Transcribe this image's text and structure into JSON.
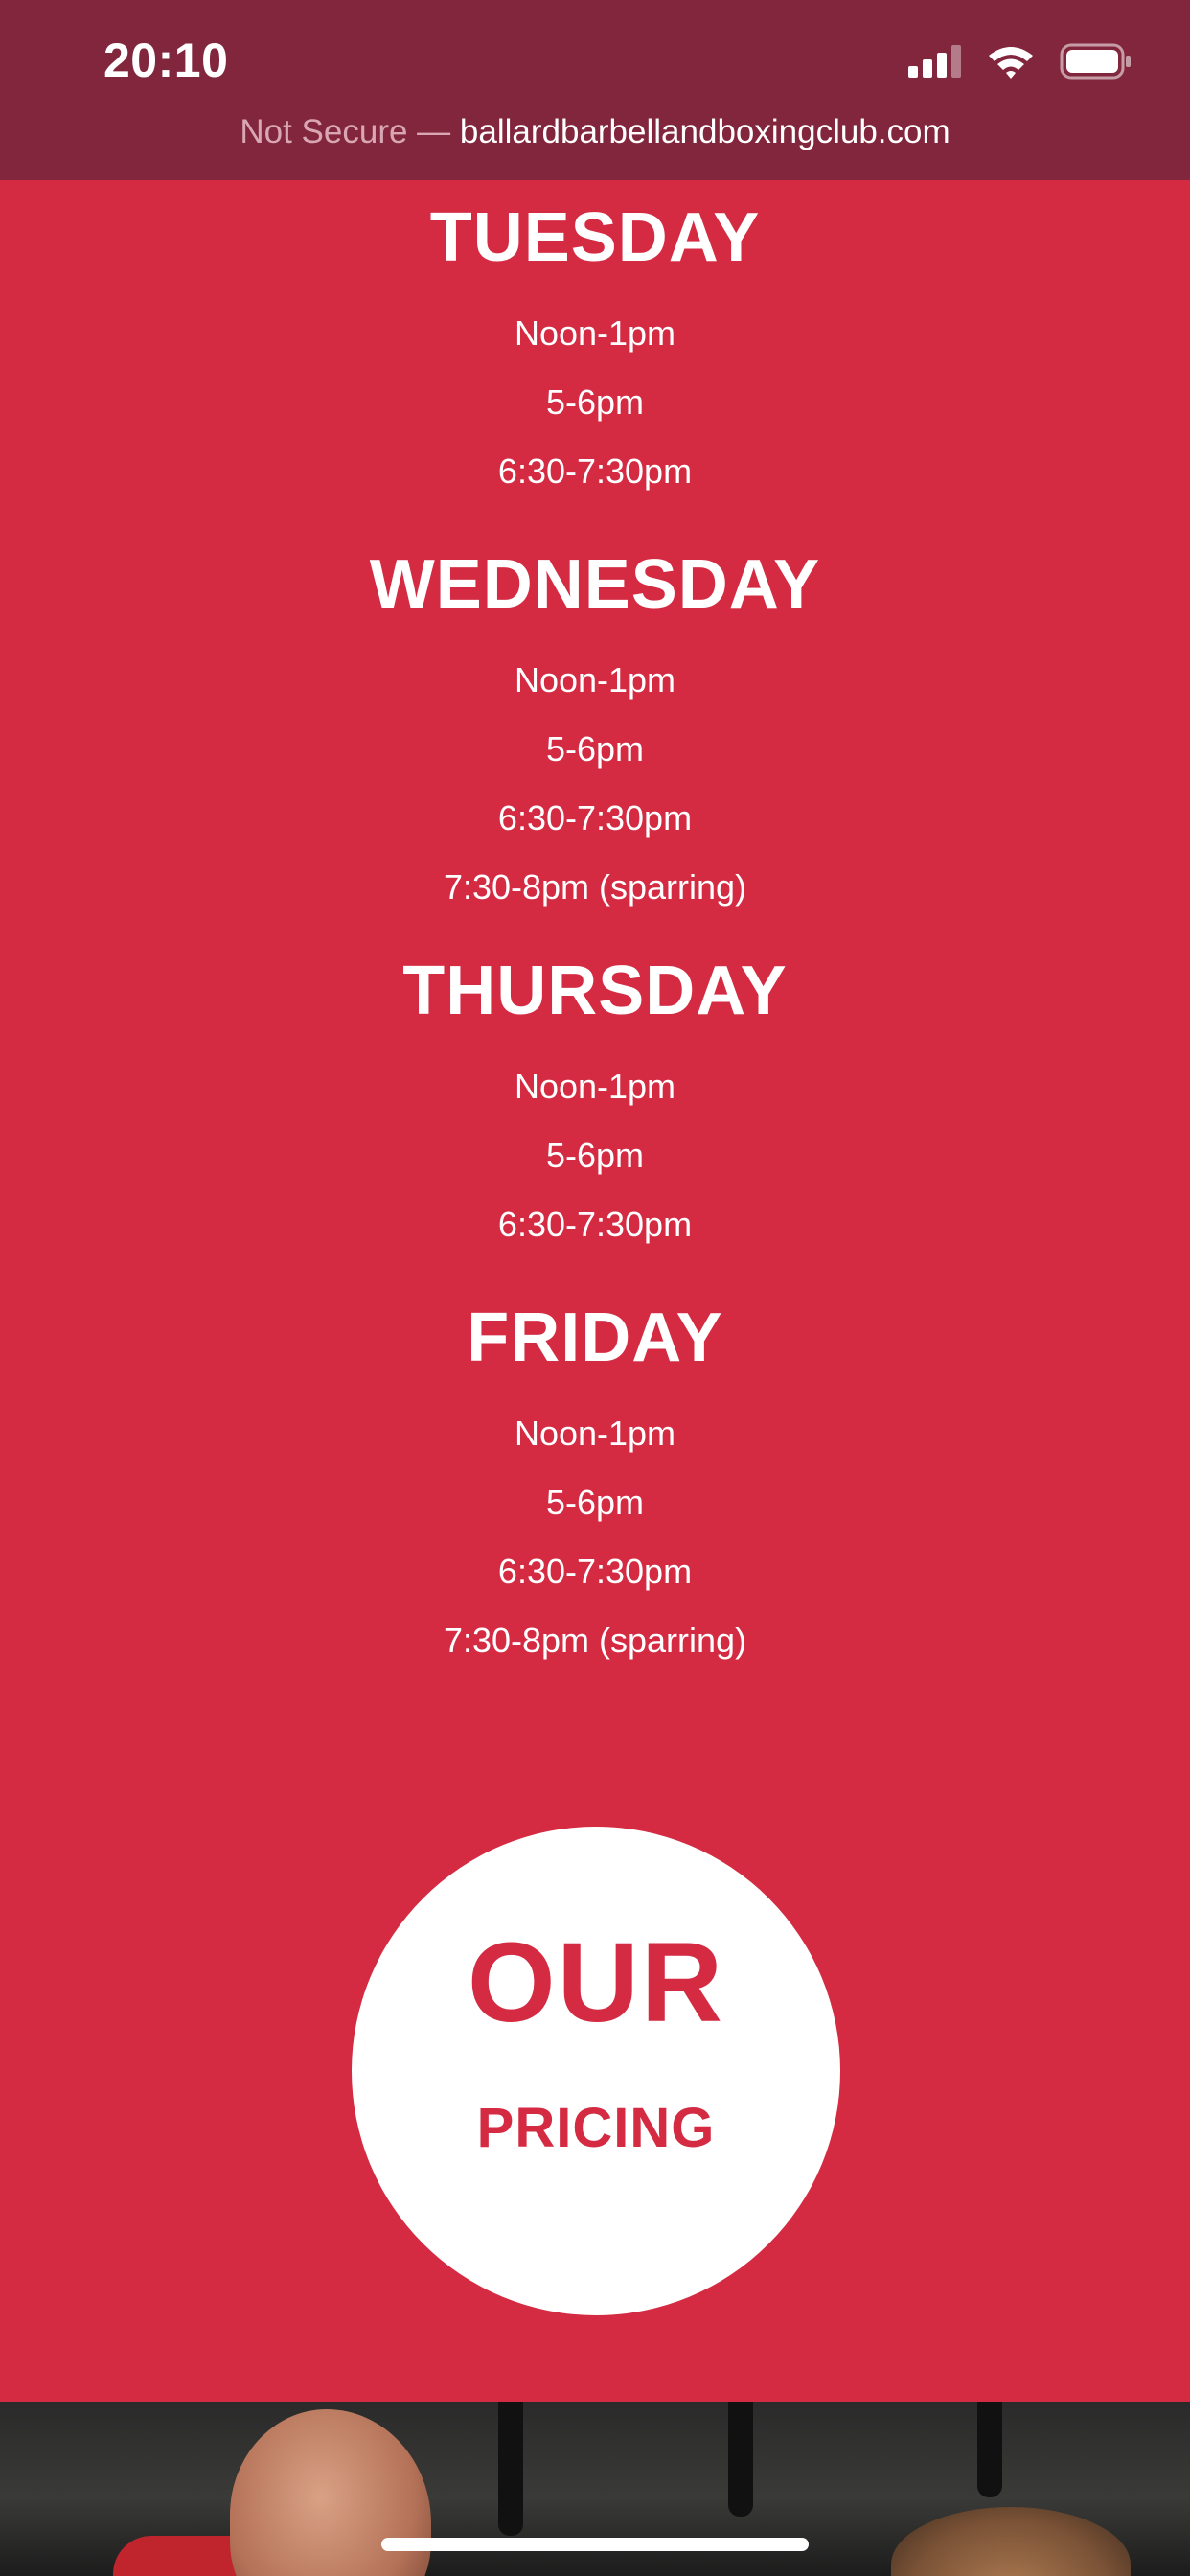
{
  "status_bar": {
    "time": "20:10",
    "icons": [
      "signal-icon",
      "wifi-icon",
      "battery-icon"
    ]
  },
  "address_bar": {
    "security_label": "Not Secure",
    "separator": " — ",
    "domain": "ballardbarbellandboxingclub.com"
  },
  "schedule": {
    "days": [
      {
        "name": "TUESDAY",
        "times": [
          "Noon-1pm",
          "5-6pm",
          "6:30-7:30pm"
        ]
      },
      {
        "name": "WEDNESDAY",
        "times": [
          "Noon-1pm",
          "5-6pm",
          "6:30-7:30pm",
          "7:30-8pm (sparring)"
        ]
      },
      {
        "name": "THURSDAY",
        "times": [
          "Noon-1pm",
          "5-6pm",
          "6:30-7:30pm"
        ]
      },
      {
        "name": "FRIDAY",
        "times": [
          "Noon-1pm",
          "5-6pm",
          "6:30-7:30pm",
          "7:30-8pm (sparring)"
        ]
      }
    ]
  },
  "pricing_button": {
    "line1": "OUR",
    "line2": "PRICING"
  },
  "colors": {
    "page_background": "#d42b43",
    "status_bar_background": "#82263d",
    "text": "#ffffff",
    "pricing_text": "#d42b43"
  }
}
